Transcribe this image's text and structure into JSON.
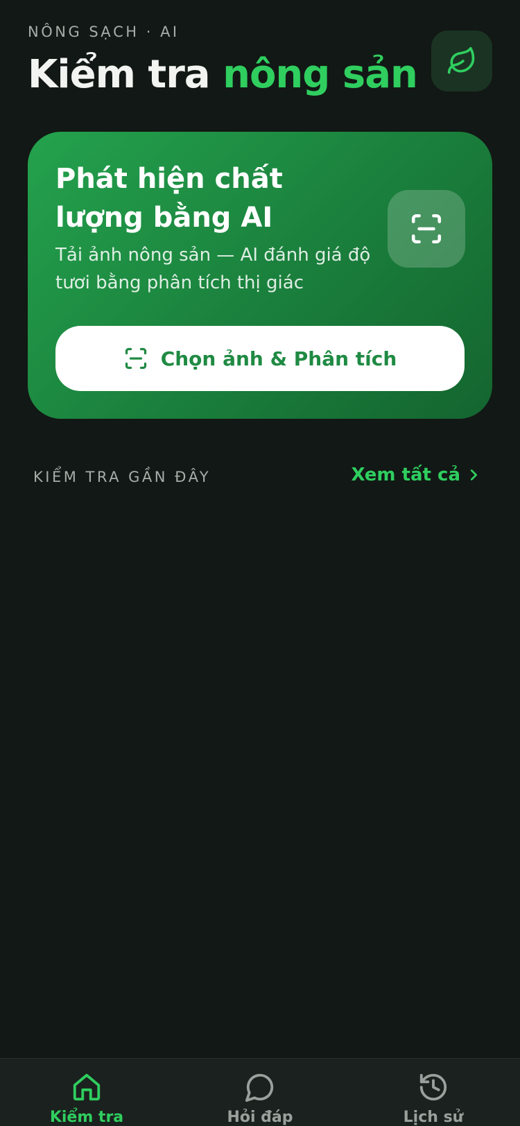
{
  "header": {
    "eyebrow": "NÔNG SẠCH · AI",
    "title_main": "Kiểm tra ",
    "title_accent": "nông sản",
    "leaf_icon": "leaf-icon"
  },
  "hero": {
    "title": "Phát hiện chất lượng bằng AI",
    "subtitle": "Tải ảnh nông sản — AI đánh giá độ tươi bằng phân tích thị giác",
    "icon": "scan-icon",
    "cta_label": "Chọn ảnh & Phân tích"
  },
  "recent": {
    "section_title": "KIỂM TRA GẦN ĐÂY",
    "see_all_label": "Xem tất cả"
  },
  "tabs": [
    {
      "label": "Kiểm tra",
      "icon": "home-icon",
      "active": true
    },
    {
      "label": "Hỏi đáp",
      "icon": "chat-bubble-icon",
      "active": false
    },
    {
      "label": "Lịch sử",
      "icon": "history-icon",
      "active": false
    }
  ],
  "colors": {
    "background": "#121815",
    "accent": "#2fce5f",
    "hero_green": "#1a7f3c",
    "tabbar": "#1b211e"
  }
}
